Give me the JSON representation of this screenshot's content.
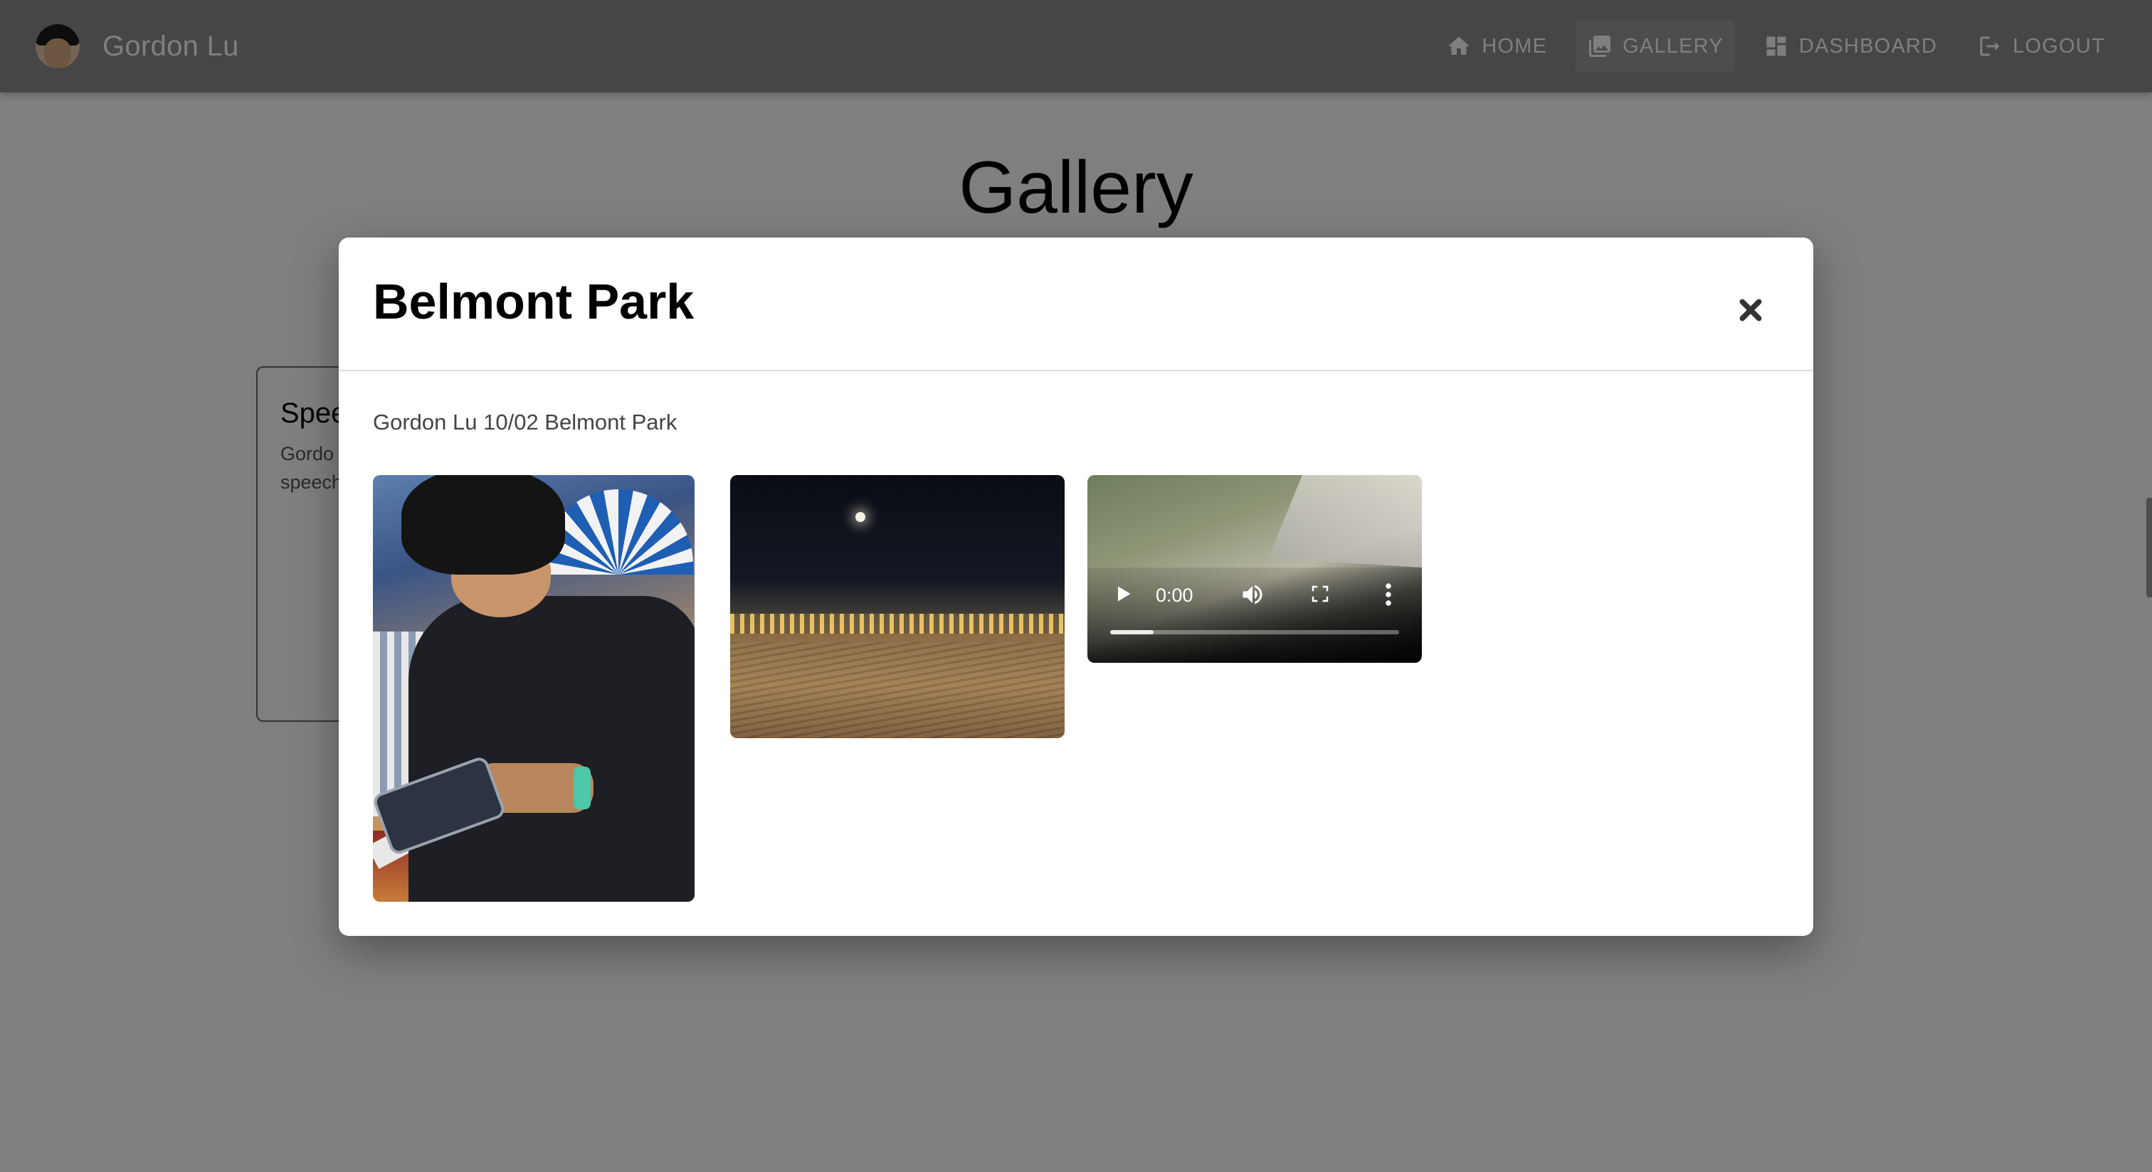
{
  "header": {
    "brand_name": "Gordon Lu",
    "nav": [
      {
        "label": "HOME",
        "icon": "home-icon"
      },
      {
        "label": "GALLERY",
        "icon": "photo-library-icon",
        "active": true
      },
      {
        "label": "DASHBOARD",
        "icon": "dashboard-icon"
      },
      {
        "label": "LOGOUT",
        "icon": "logout-icon"
      }
    ]
  },
  "page": {
    "title": "Gallery",
    "card": {
      "title": "Spee",
      "desc_line1": "Gordo",
      "desc_line2": "speech"
    }
  },
  "modal": {
    "title": "Belmont Park",
    "caption": "Gordon Lu 10/02 Belmont Park",
    "media": [
      {
        "type": "image",
        "subject": "boy using phone at boardwalk"
      },
      {
        "type": "image",
        "subject": "beach at night with moon"
      },
      {
        "type": "video",
        "time": "0:00",
        "progress": 0.15
      }
    ]
  },
  "colors": {
    "backdrop": "#000000",
    "appbar": "#8c8c8c",
    "text_primary": "#000000"
  }
}
